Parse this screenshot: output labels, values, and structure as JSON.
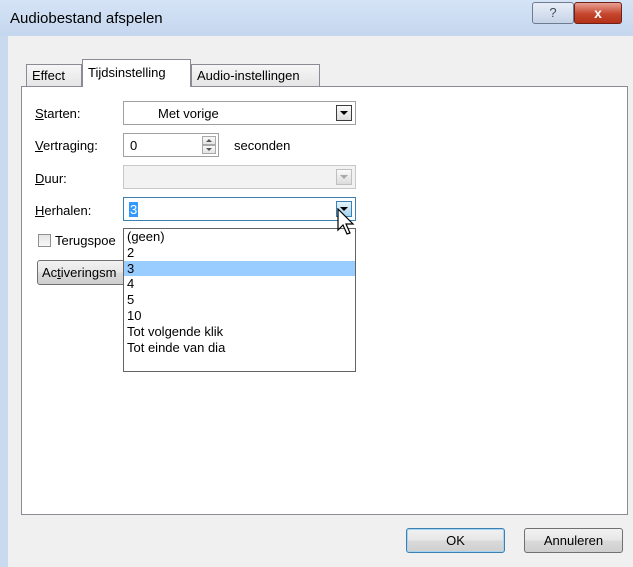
{
  "window": {
    "title": "Audiobestand afspelen",
    "help_glyph": "?",
    "close_glyph": "x"
  },
  "tabs": [
    {
      "label": "Effect",
      "active": false
    },
    {
      "label": "Tijdsinstelling",
      "active": true
    },
    {
      "label": "Audio-instellingen",
      "active": false
    }
  ],
  "form": {
    "starten": {
      "label_u": "S",
      "label_rest": "tarten:",
      "value": "Met vorige"
    },
    "vertraging": {
      "label_u": "V",
      "label_rest": "ertraging:",
      "value": "0",
      "unit": "seconden"
    },
    "duur": {
      "label_u": "D",
      "label_rest": "uur:",
      "value": ""
    },
    "herhalen": {
      "label_u": "H",
      "label_rest": "erhalen:",
      "value": "3"
    },
    "terugspoelen": {
      "label_start": "Teru",
      "label_u": "g",
      "label_rest": "spoe",
      "checked": false
    },
    "activering_button": {
      "label_start": "Ac",
      "label_u": "t",
      "label_rest": "iveringsm"
    }
  },
  "dropdown": {
    "options": [
      "(geen)",
      "2",
      "3",
      "4",
      "5",
      "10",
      "Tot volgende klik",
      "Tot einde van dia"
    ],
    "selected_index": 2
  },
  "footer": {
    "ok_label": "OK",
    "cancel_label": "Annuleren"
  },
  "colors": {
    "selection": "#99ccff",
    "titlebar": "#c5d7ef",
    "close_button": "#c5462d"
  }
}
